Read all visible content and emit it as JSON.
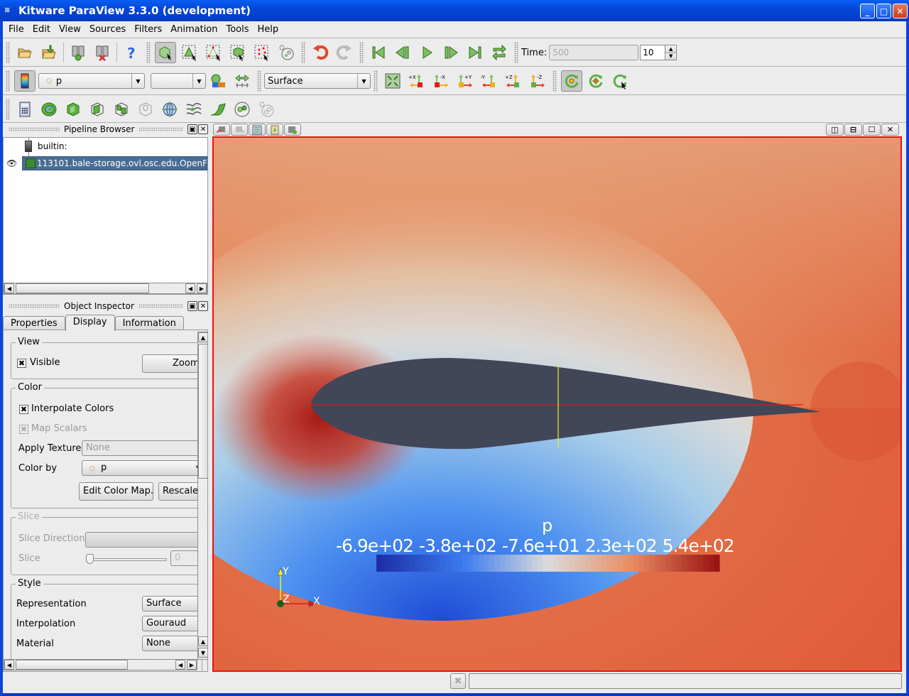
{
  "window": {
    "title": "Kitware ParaView 3.3.0 (development)",
    "controls": {
      "minimize": "minimize-icon",
      "maximize": "maximize-icon",
      "close": "close-icon"
    }
  },
  "menu": [
    "File",
    "Edit",
    "View",
    "Sources",
    "Filters",
    "Animation",
    "Tools",
    "Help"
  ],
  "toolbar1": {
    "buttons": [
      "open-file",
      "load-state",
      "connect",
      "disconnect",
      "help",
      "interact",
      "select-cells-on",
      "select-points-on",
      "select-cells-frustum",
      "select-points-frustum",
      "select-block",
      "undo",
      "redo",
      "first-frame",
      "previous-frame",
      "play",
      "next-frame",
      "last-frame",
      "loop"
    ],
    "time_label": "Time:",
    "time_value": "500",
    "timestep_value": "10"
  },
  "toolbar2": {
    "color_array": "p",
    "component": "",
    "representation": "Surface",
    "camera_buttons": [
      "reset-camera",
      "+X",
      "-X",
      "+Y",
      "-Y",
      "+Z",
      "-Z"
    ],
    "center_buttons": [
      "show-center",
      "reset-center",
      "pick-center"
    ]
  },
  "toolbar3": {
    "filters": [
      "calculator",
      "contour",
      "clip",
      "slice",
      "threshold",
      "extract-subset",
      "glyph",
      "stream-tracer",
      "warp",
      "group-datasets",
      "extract-level"
    ]
  },
  "pipeline_browser": {
    "title": "Pipeline Browser",
    "items": [
      {
        "label": "builtin:",
        "icon": "server-icon"
      },
      {
        "label": "113101.bale-storage.ovl.osc.edu.OpenF",
        "icon": "dataset-icon",
        "visible": true,
        "selected": true
      }
    ]
  },
  "object_inspector": {
    "title": "Object Inspector",
    "tabs": [
      "Properties",
      "Display",
      "Information"
    ],
    "active_tab": "Display",
    "view_group": {
      "title": "View",
      "visible_label": "Visible",
      "visible_checked": true,
      "zoom_button": "Zoom"
    },
    "color_group": {
      "title": "Color",
      "interpolate_label": "Interpolate Colors",
      "interpolate_checked": true,
      "map_scalars_label": "Map Scalars",
      "apply_texture_label": "Apply Texture",
      "apply_texture_value": "None",
      "color_by_label": "Color by",
      "color_by_value": "p",
      "edit_color_map": "Edit Color Map...",
      "rescale": "Rescale"
    },
    "slice_group": {
      "title": "Slice",
      "slice_direction_label": "Slice Direction",
      "slice_label": "Slice",
      "slice_value": "0"
    },
    "style_group": {
      "title": "Style",
      "representation_label": "Representation",
      "representation_value": "Surface",
      "interpolation_label": "Interpolation",
      "interpolation_value": "Gouraud",
      "material_label": "Material",
      "material_value": "None"
    }
  },
  "viewport": {
    "scalar_bar": {
      "title": "p",
      "labels": [
        "-6.9e+02",
        "-3.8e+02",
        "-7.6e+01",
        "2.3e+02",
        "5.4e+02"
      ],
      "range": [
        -690,
        540
      ],
      "colors": [
        "#1d2fa6",
        "#3b7bef",
        "#dcdcdc",
        "#e98b62",
        "#9a1512"
      ]
    },
    "axes": {
      "x": "X",
      "y": "Y",
      "z": "Z"
    },
    "background_color": "#e2643a",
    "airfoil_color": "#424659",
    "active_border_color": "#f01010"
  },
  "status_bar": {
    "progress_text": ""
  }
}
